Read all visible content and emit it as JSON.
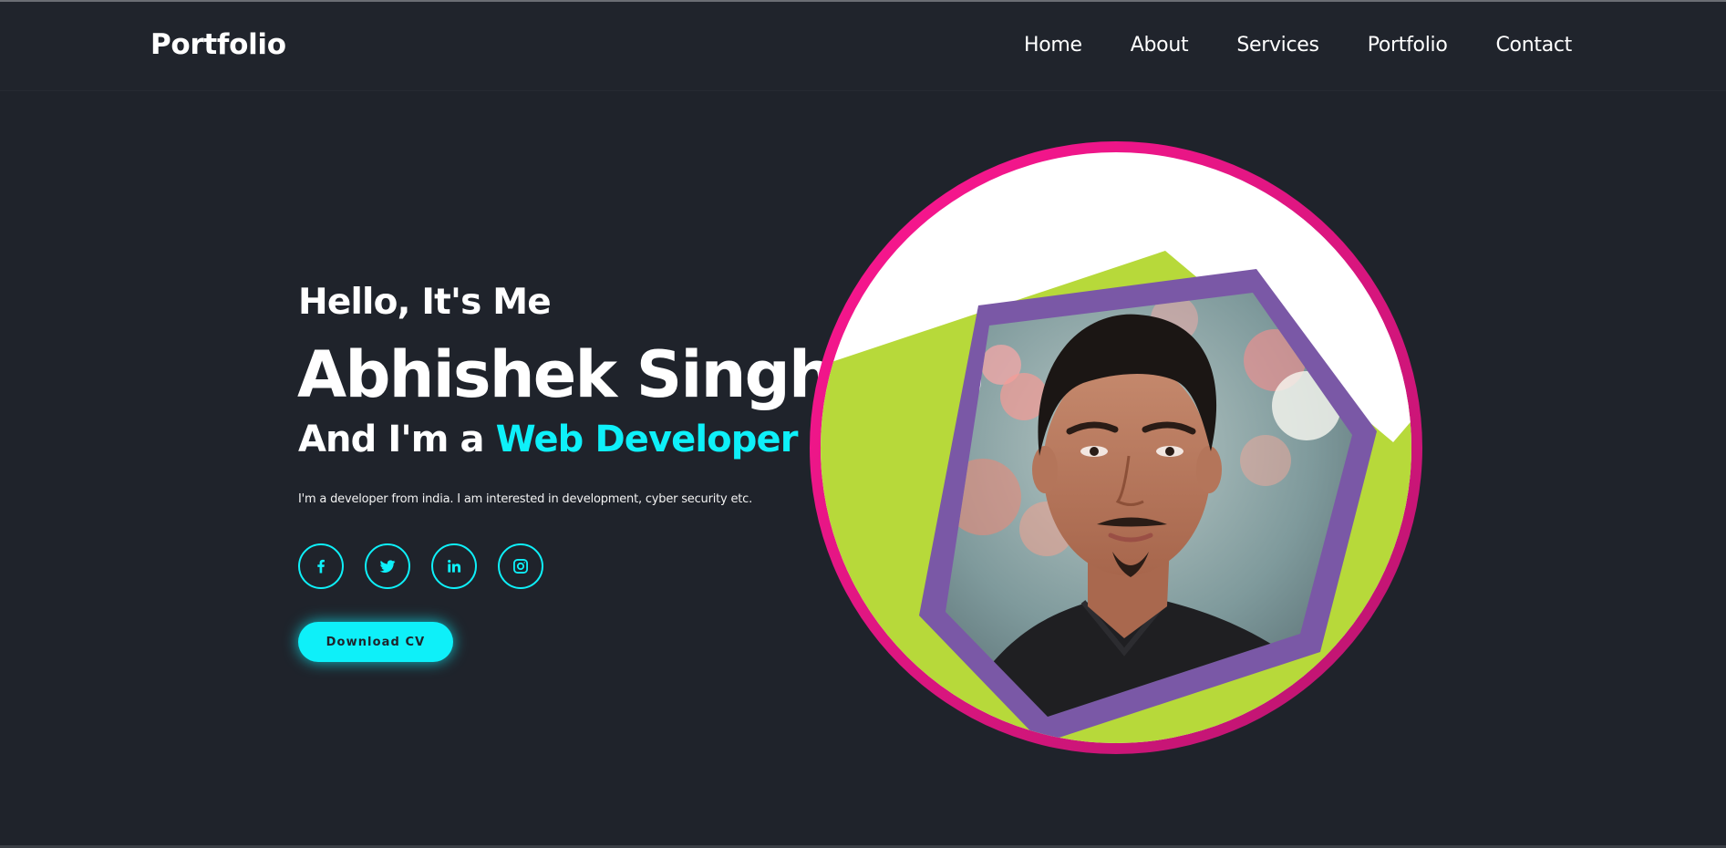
{
  "header": {
    "logo": "Portfolio",
    "nav": [
      "Home",
      "About",
      "Services",
      "Portfolio",
      "Contact"
    ]
  },
  "hero": {
    "greeting": "Hello, It's Me",
    "name": "Abhishek Singh",
    "role_prefix": "And I'm a ",
    "role_highlight": "Web Developer",
    "description": "I'm a developer from india. I am interested in development, cyber security etc.",
    "cv_button": "Download CV"
  },
  "socials": [
    "facebook-icon",
    "twitter-icon",
    "linkedin-icon",
    "instagram-icon"
  ],
  "colors": {
    "background": "#1f232b",
    "accent": "#0ef0f9",
    "ring": "#e9168c",
    "hexagon": "#7a58a6",
    "lime": "#b7d93a"
  }
}
